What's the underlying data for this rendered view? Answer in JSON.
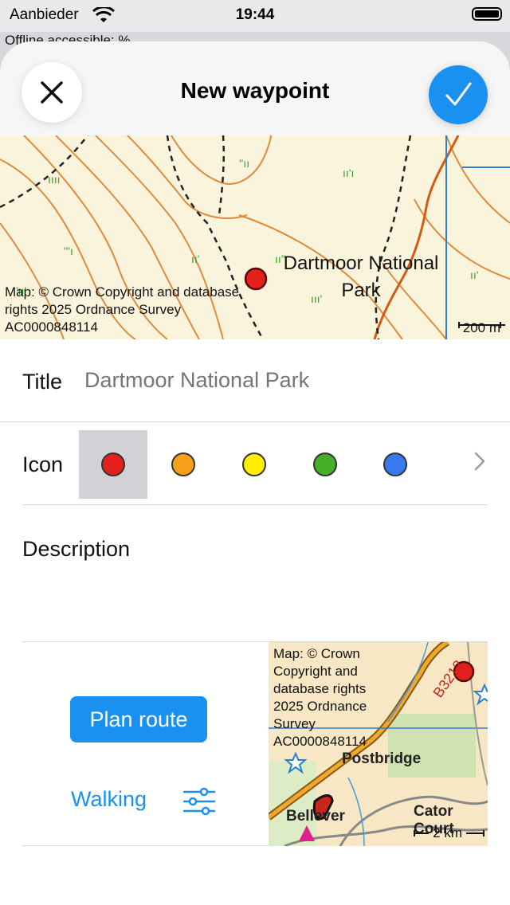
{
  "status_bar": {
    "carrier": "Aanbieder",
    "time": "19:44"
  },
  "background": {
    "offline_text": "Offline accessible:  %"
  },
  "header": {
    "title": "New waypoint",
    "close_icon": "close-icon",
    "confirm_icon": "checkmark-icon",
    "accent_color": "#1a91f0"
  },
  "map_top": {
    "place_label": "Dartmoor National Park",
    "attribution": "Map: © Crown Copyright and database rights 2025 Ordnance Survey AC0000848114",
    "scale": "200 m"
  },
  "form": {
    "title_label": "Title",
    "title_placeholder": "Dartmoor National Park",
    "title_value": "",
    "icon_label": "Icon",
    "icon_colors": [
      "#e3201b",
      "#f7a11a",
      "#ffee00",
      "#44b02a",
      "#3a78f0"
    ],
    "selected_icon_index": 0,
    "description_label": "Description"
  },
  "route": {
    "plan_label": "Plan route",
    "mode_label": "Walking",
    "mini_map": {
      "attribution": "Map: © Crown Copyright and database rights 2025 Ordnance Survey AC0000848114",
      "place_1": "Postbridge",
      "place_2": "Bellever",
      "place_3": "Cator Court",
      "road": "B3212",
      "scale": "2 km"
    }
  }
}
